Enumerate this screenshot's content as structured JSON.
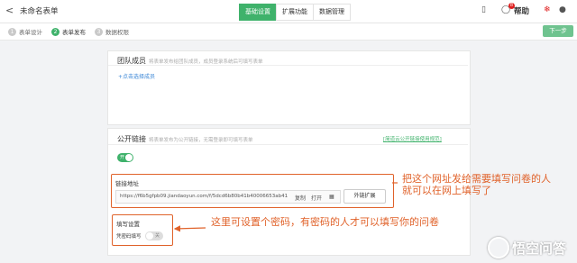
{
  "header": {
    "back_glyph": "<",
    "title": "未命名表单",
    "tabs": [
      {
        "label": "基础设置",
        "active": true
      },
      {
        "label": "扩展功能",
        "active": false
      },
      {
        "label": "数据管理",
        "active": false
      }
    ],
    "notification_count": "8",
    "help_label": "帮助"
  },
  "steps": [
    {
      "num": "1",
      "label": "表单设计",
      "active": false
    },
    {
      "num": "2",
      "label": "表单发布",
      "active": true
    },
    {
      "num": "3",
      "label": "数据权限",
      "active": false
    }
  ],
  "next_button": "下一步",
  "team": {
    "title": "团队成员",
    "hint": "将表单发布给团队成员，成员登录系统后可填写表单",
    "add_link": "+点击选择成员"
  },
  "public_link": {
    "title": "公开链接",
    "hint": "将表单发布为公开链接，无需登录即可填写表单",
    "help_link": "[简道云公开链接使用规范]",
    "toggle_label": "开",
    "address_label": "链接地址",
    "url": "https://f6b5gfpb09.jiandaoyun.com/f/5dcd6b80b41b40006653ab41",
    "copy_label": "复制",
    "open_label": "打开",
    "extend_button": "外链扩展"
  },
  "fill_settings": {
    "title": "填写设置",
    "password_label": "凭密码填写",
    "toggle_label": "关"
  },
  "annotations": {
    "link_note_line1": "把这个网址发给需要填写问卷的人",
    "link_note_line2": "就可以在网上填写了",
    "password_note": "这里可设置个密码，有密码的人才可以填写你的问卷"
  },
  "watermark": "悟空问答",
  "colors": {
    "accent": "#3fb26b",
    "annotation": "#e0622a",
    "link": "#3a86d6"
  }
}
